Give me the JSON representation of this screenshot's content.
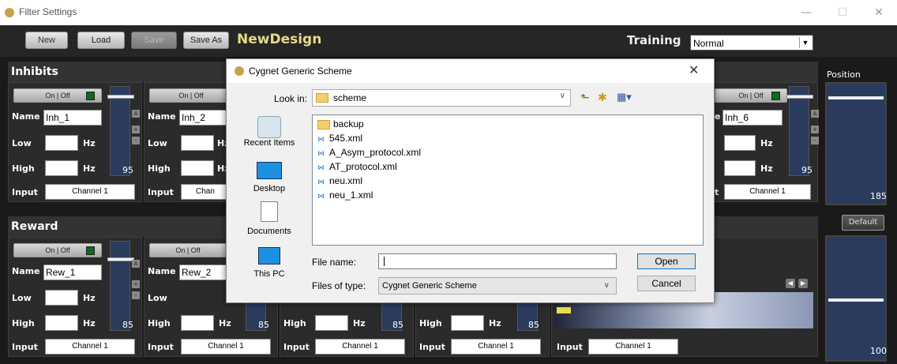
{
  "window": {
    "title": "Filter Settings",
    "minimize": "—",
    "maximize": "☐",
    "close": "✕"
  },
  "toolbar": {
    "new_label": "New",
    "load_label": "Load",
    "save_label": "Save",
    "save_as_label": "Save As",
    "design_name": "NewDesign",
    "training_label": "Training",
    "training_value": "Normal"
  },
  "inhibits": {
    "header": "Inhibits",
    "panels": [
      {
        "onoff": "On | Off",
        "name_label": "Name",
        "name": "Inh_1",
        "low_label": "Low",
        "high_label": "High",
        "hz": "Hz",
        "input_label": "Input",
        "input": "Channel 1",
        "slider_value": "95"
      },
      {
        "onoff": "On | Off",
        "name_label": "Name",
        "name": "Inh_2",
        "low_label": "Low",
        "high_label": "High",
        "hz": "Hz",
        "input_label": "Input",
        "input": "Chan"
      },
      {
        "onoff": "On | Off",
        "name_label": "e",
        "name": "Inh_6",
        "low_label": "",
        "high_label": "",
        "hz": "Hz",
        "input_label": "t",
        "input": "Channel 1",
        "slider_value": "95"
      }
    ]
  },
  "reward": {
    "header": "Reward",
    "panels": [
      {
        "onoff": "On | Off",
        "name_label": "Name",
        "name": "Rew_1",
        "low_label": "Low",
        "high_label": "High",
        "hz": "Hz",
        "input_label": "Input",
        "input": "Channel 1",
        "slider_value": "85"
      },
      {
        "onoff": "On | Off",
        "name_label": "Name",
        "name": "Rew_2",
        "low_label": "Low",
        "high_label": "High",
        "hz": "Hz",
        "input_label": "Input",
        "input": "Channel 1",
        "slider_value": "85"
      },
      {
        "high_label": "High",
        "hz": "Hz",
        "input_label": "Input",
        "input": "Channel 1",
        "slider_value": "85"
      },
      {
        "high_label": "High",
        "hz": "Hz",
        "input_label": "Input",
        "input": "Channel 1",
        "slider_value": "85"
      },
      {
        "input_label": "Input",
        "input": "Channel 1"
      }
    ]
  },
  "position": {
    "label": "Position",
    "value_top": "185",
    "default_label": "Default",
    "value_bottom": "100"
  },
  "dialog": {
    "title": "Cygnet Generic Scheme",
    "close": "✕",
    "look_in_label": "Look in:",
    "look_in_value": "scheme",
    "places": [
      "Recent Items",
      "Desktop",
      "Documents",
      "This PC"
    ],
    "files": [
      {
        "name": "backup",
        "type": "folder"
      },
      {
        "name": "545.xml",
        "type": "xml"
      },
      {
        "name": "A_Asym_protocol.xml",
        "type": "xml"
      },
      {
        "name": "AT_protocol.xml",
        "type": "xml"
      },
      {
        "name": "neu.xml",
        "type": "xml"
      },
      {
        "name": "neu_1.xml",
        "type": "xml"
      }
    ],
    "file_name_label": "File name:",
    "file_name_value": "",
    "files_of_type_label": "Files of type:",
    "files_of_type_value": "Cygnet Generic Scheme",
    "open_label": "Open",
    "cancel_label": "Cancel"
  },
  "colors": {
    "accent_title": "#e6d98a",
    "slider_fill": "#2a3b5e",
    "led": "#0d6b1a",
    "dialog_accent": "#0078d7"
  }
}
